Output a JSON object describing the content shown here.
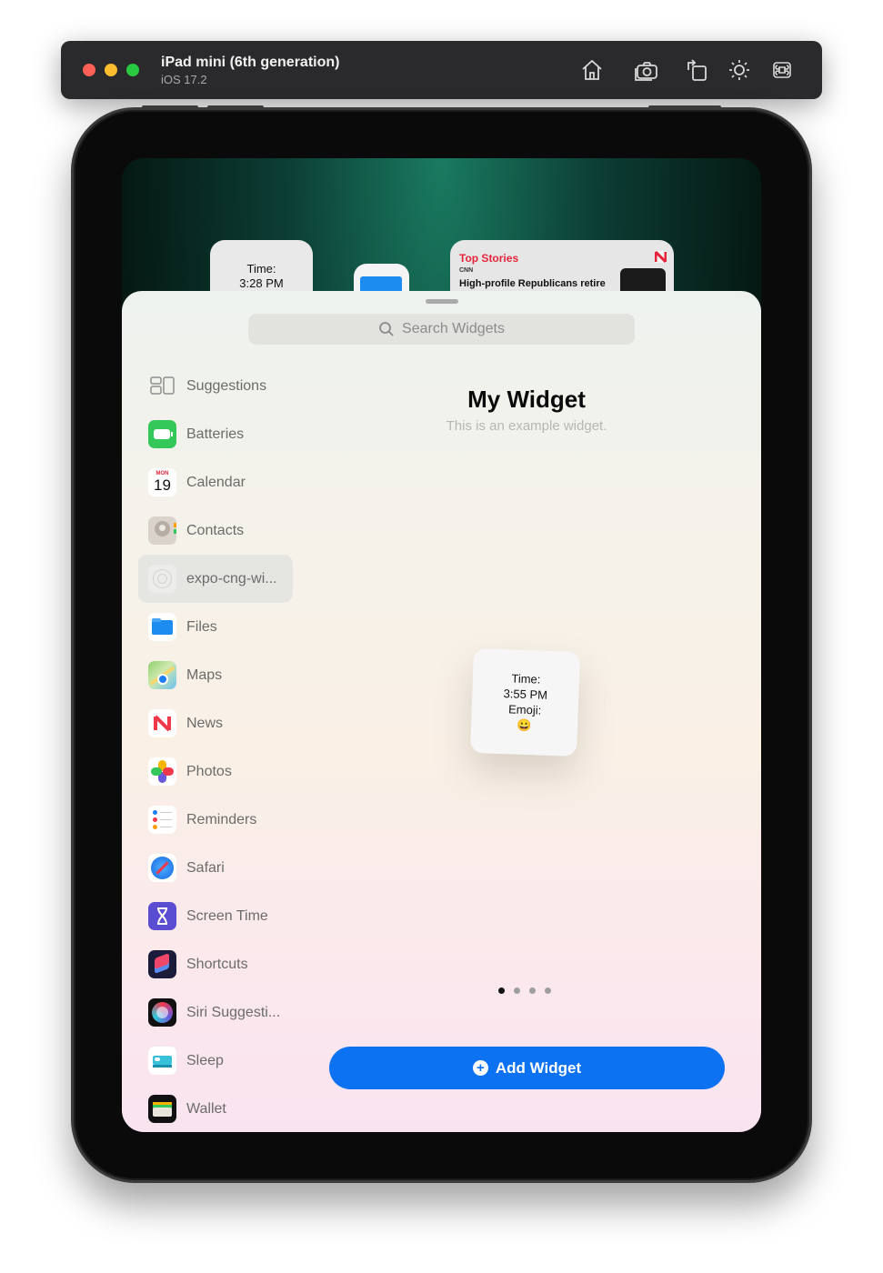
{
  "simulator": {
    "device_name": "iPad mini (6th generation)",
    "os_version": "iOS 17.2",
    "toolbar_icons": [
      "home-icon",
      "screenshot-icon",
      "rotate-icon",
      "appearance-icon",
      "command-icon"
    ]
  },
  "home_screen": {
    "time_widget": {
      "label": "Time:",
      "time": "3:28 PM"
    },
    "news_widget": {
      "title": "Top Stories",
      "source": "CNN",
      "headline": "High-profile Republicans retire"
    }
  },
  "gallery": {
    "search_placeholder": "Search Widgets",
    "apps": [
      {
        "label": "Suggestions",
        "icon": "suggestions-icon"
      },
      {
        "label": "Batteries",
        "icon": "batteries-icon"
      },
      {
        "label": "Calendar",
        "icon": "calendar-icon",
        "cal_month": "MON",
        "cal_day": "19"
      },
      {
        "label": "Contacts",
        "icon": "contacts-icon"
      },
      {
        "label": "expo-cng-wi...",
        "icon": "expo-app-icon",
        "selected": true
      },
      {
        "label": "Files",
        "icon": "files-icon"
      },
      {
        "label": "Maps",
        "icon": "maps-icon"
      },
      {
        "label": "News",
        "icon": "news-icon"
      },
      {
        "label": "Photos",
        "icon": "photos-icon"
      },
      {
        "label": "Reminders",
        "icon": "reminders-icon"
      },
      {
        "label": "Safari",
        "icon": "safari-icon"
      },
      {
        "label": "Screen Time",
        "icon": "screen-time-icon"
      },
      {
        "label": "Shortcuts",
        "icon": "shortcuts-icon"
      },
      {
        "label": "Siri Suggesti...",
        "icon": "siri-icon"
      },
      {
        "label": "Sleep",
        "icon": "sleep-icon"
      },
      {
        "label": "Wallet",
        "icon": "wallet-icon"
      }
    ],
    "detail": {
      "title": "My Widget",
      "subtitle": "This is an example widget.",
      "preview": {
        "time_label": "Time:",
        "time": "3:55 PM",
        "emoji_label": "Emoji:",
        "emoji": "😀"
      },
      "page_count": 4,
      "current_page": 1,
      "add_button": "Add Widget"
    }
  },
  "colors": {
    "accent": "#0d72f2",
    "news_red": "#e5243b"
  }
}
